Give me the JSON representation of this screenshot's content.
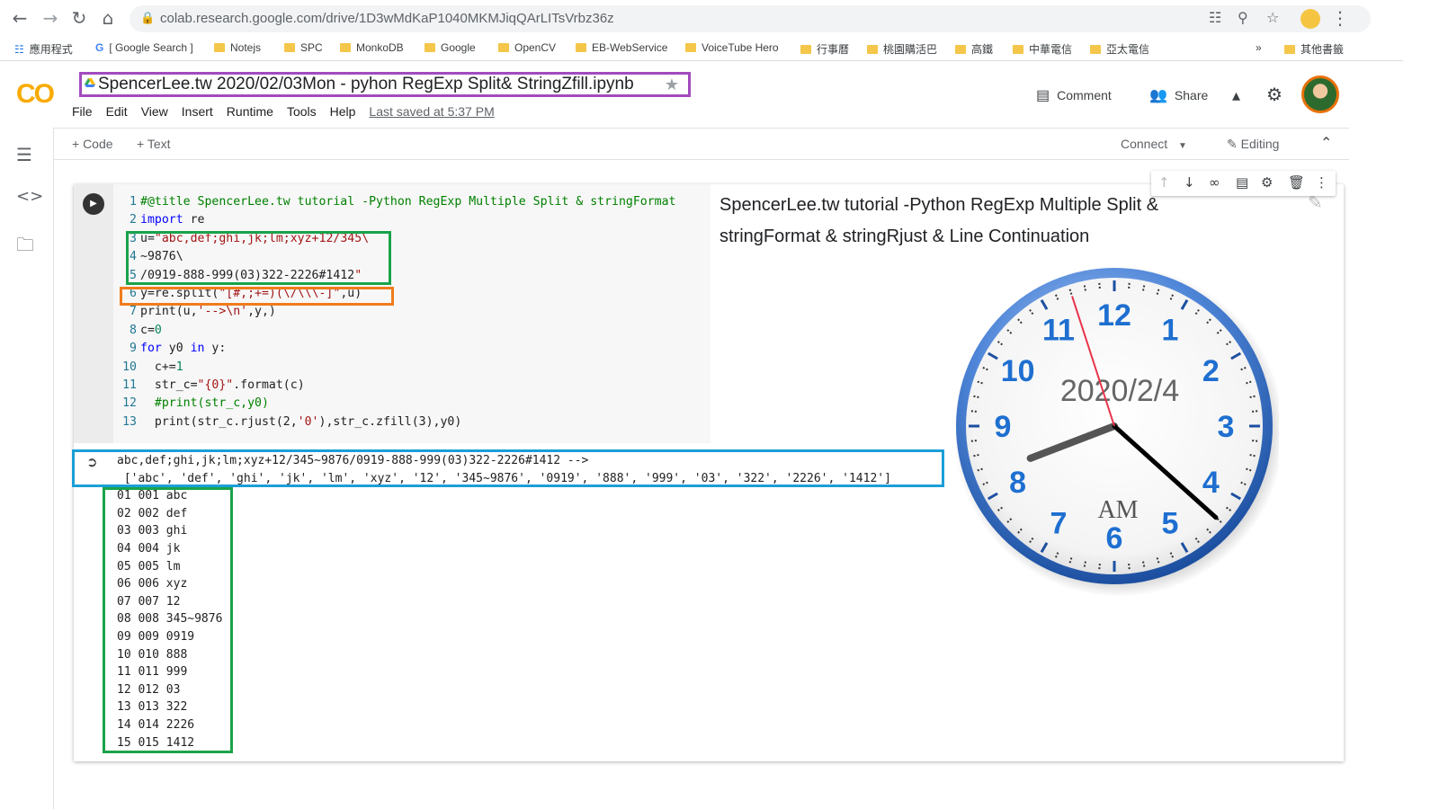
{
  "browser": {
    "url": "colab.research.google.com/drive/1D3wMdKaP1040MKMJiqQArLITsVrbz36z",
    "bookmarks": [
      "應用程式",
      "[ Google Search ]",
      "Notejs",
      "SPC",
      "MonkoDB",
      "Google",
      "OpenCV",
      "EB-WebService",
      "VoiceTube Hero",
      "行事曆",
      "桃園購活巴",
      "高鐵",
      "中華電信",
      "亞太電信"
    ],
    "overflow": "»",
    "other_bookmarks": "其他書籤"
  },
  "colab": {
    "logo": "CO",
    "title": "SpencerLee.tw 2020/02/03Mon - pyhon RegExp Split& StringZfill.ipynb",
    "menu": [
      "File",
      "Edit",
      "View",
      "Insert",
      "Runtime",
      "Tools",
      "Help"
    ],
    "last_saved": "Last saved at 5:37 PM",
    "comment": "Comment",
    "share": "Share"
  },
  "toolbar": {
    "add_code": "+ Code",
    "add_text": "+ Text",
    "connect": "Connect",
    "editing": "Editing"
  },
  "cell": {
    "code_lines": [
      "1 #@title SpencerLee.tw tutorial -Python RegExp Multiple Split & stringFormat",
      "2 import re",
      "3 u=\"abc,def;ghi,jk;lm;xyz+12/345\\",
      "4 ~9876\\",
      "5 /0919-888-999(03)322-2226#1412\"",
      "6 y=re.split(\"[#,;+=)(\\/\\\\\\-]\",u)",
      "7 print(u,'-->\\n',y,)",
      "8 c=0",
      "9 for y0 in y:",
      "10   c+=1",
      "11   str_c=\"{0}\".format(c)",
      "12   #print(str_c,y0)",
      "13   print(str_c.rjust(2,'0'),str_c.zfill(3),y0)"
    ],
    "form_title": "SpencerLee.tw tutorial -Python RegExp Multiple Split & stringFormat & stringRjust & Line Continuation",
    "output_line1": "abc,def;ghi,jk;lm;xyz+12/345~9876/0919-888-999(03)322-2226#1412 -->",
    "output_line2": " ['abc', 'def', 'ghi', 'jk', 'lm', 'xyz', '12', '345~9876', '0919', '888', '999', '03', '322', '2226', '1412']",
    "output_rows": [
      "01 001 abc",
      "02 002 def",
      "03 003 ghi",
      "04 004 jk",
      "05 005 lm",
      "06 006 xyz",
      "07 007 12",
      "08 008 345~9876",
      "09 009 0919",
      "10 010 888",
      "11 011 999",
      "12 012 03",
      "13 013 322",
      "14 014 2226",
      "15 015 1412"
    ]
  },
  "clock": {
    "date": "2020/2/4",
    "ampm": "AM",
    "numerals": [
      "12",
      "1",
      "2",
      "3",
      "4",
      "5",
      "6",
      "7",
      "8",
      "9",
      "10",
      "11"
    ],
    "hour": 8.3,
    "minute": 22,
    "second": 57
  },
  "colors": {
    "title_box": "#a24bbd",
    "green_box": "#1aa34a",
    "orange_box": "#f07c1c",
    "blue_box": "#1a9fd8"
  },
  "icons": [
    "back-icon",
    "forward-icon",
    "reload-icon",
    "home-icon",
    "lock-icon",
    "translate-icon",
    "zoom-icon",
    "star-icon",
    "profile-icon",
    "more-icon",
    "apps-icon",
    "folder-icon",
    "drive-icon",
    "comment-icon",
    "share-icon",
    "flask-icon",
    "gear-icon",
    "toc-icon",
    "code-icon",
    "files-icon",
    "run-icon",
    "pencil-icon",
    "output-icon",
    "arrow-up-icon",
    "arrow-down-icon",
    "link-icon",
    "comment-cell-icon",
    "delete-icon"
  ]
}
